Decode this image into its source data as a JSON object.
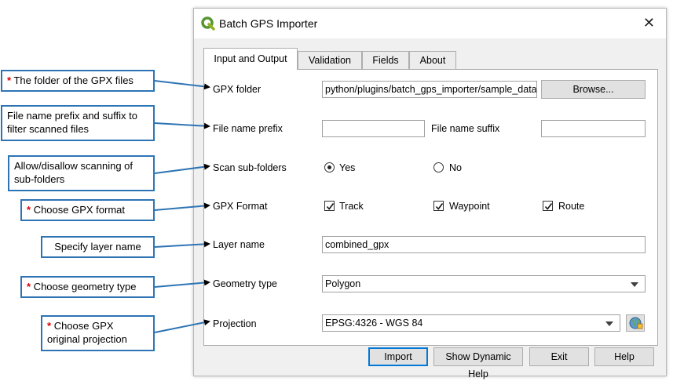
{
  "callouts": [
    {
      "star": "*",
      "text": "The folder of the GPX files"
    },
    {
      "star": "",
      "text": "File name prefix and suffix to filter scanned files"
    },
    {
      "star": "",
      "text": "Allow/disallow scanning of sub-folders"
    },
    {
      "star": "*",
      "text": "Choose GPX format"
    },
    {
      "star": "",
      "text": "Specify layer name"
    },
    {
      "star": "*",
      "text": "Choose geometry type"
    },
    {
      "star": "*",
      "text": "Choose GPX original projection"
    }
  ],
  "window": {
    "title": "Batch GPS Importer",
    "close": "✕",
    "app_icon": "qgis-logo-icon"
  },
  "tabs": [
    "Input and Output",
    "Validation",
    "Fields",
    "About"
  ],
  "form": {
    "gpx_folder_label": "GPX folder",
    "gpx_folder_value": "python/plugins/batch_gps_importer/sample_data",
    "browse_label": "Browse...",
    "prefix_label": "File name prefix",
    "prefix_value": "",
    "suffix_label": "File name suffix",
    "suffix_value": "",
    "scan_label": "Scan sub-folders",
    "scan_yes": "Yes",
    "scan_no": "No",
    "scan_selected": "Yes",
    "format_label": "GPX Format",
    "format_track": "Track",
    "format_waypoint": "Waypoint",
    "format_route": "Route",
    "format_checked": [
      "Track",
      "Waypoint",
      "Route"
    ],
    "layer_label": "Layer name",
    "layer_value": "combined_gpx",
    "geometry_label": "Geometry type",
    "geometry_value": "Polygon",
    "projection_label": "Projection",
    "projection_value": "EPSG:4326 - WGS 84",
    "projection_icon": "globe-projection-icon"
  },
  "buttons": {
    "import": "Import",
    "help_dynamic": "Show Dynamic Help",
    "exit": "Exit",
    "help": "Help"
  },
  "colors": {
    "callout_border": "#2e74b5",
    "star": "#e00000",
    "default_button": "#0078d7"
  }
}
